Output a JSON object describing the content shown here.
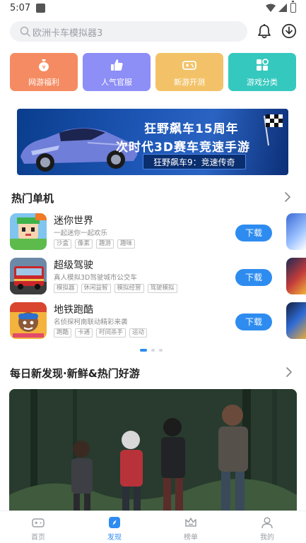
{
  "status_bar": {
    "time": "5:07"
  },
  "search": {
    "placeholder": "欧洲卡车模拟器3"
  },
  "tiles": [
    {
      "label": "网游福利",
      "color": "#f58b62"
    },
    {
      "label": "人气官服",
      "color": "#8d8ef6"
    },
    {
      "label": "新游开测",
      "color": "#f3c268"
    },
    {
      "label": "游戏分类",
      "color": "#35c8be"
    }
  ],
  "banner": {
    "line1": "狂野飙车15周年",
    "line2": "次时代3D赛车竞速手游",
    "subtitle": "狂野飙车9：竞速传奇"
  },
  "hot_section": {
    "title": "热门单机"
  },
  "games": [
    {
      "name": "迷你世界",
      "desc": "一起迷你一起欢乐",
      "tags": [
        "沙盒",
        "像素",
        "趣游",
        "趣味"
      ],
      "button": "下载"
    },
    {
      "name": "超级驾驶",
      "desc": "真人模拟3D驾驶城市公交车",
      "tags": [
        "模拟器",
        "休闲益智",
        "模拟经营",
        "驾驶模拟"
      ],
      "button": "下载"
    },
    {
      "name": "地铁跑酷",
      "desc": "名侦探柯南联动精彩来袭",
      "tags": [
        "跑酷",
        "卡通",
        "时间杀手",
        "运动"
      ],
      "button": "下载"
    }
  ],
  "pager": {
    "count": 3,
    "active_index": 0
  },
  "daily_section": {
    "title": "每日新发现·新鲜&热门好游"
  },
  "nav": [
    {
      "label": "首页",
      "icon": "gamepad-icon",
      "active": false
    },
    {
      "label": "发现",
      "icon": "compass-icon",
      "active": true
    },
    {
      "label": "榜单",
      "icon": "crown-icon",
      "active": false
    },
    {
      "label": "我的",
      "icon": "user-icon",
      "active": false
    }
  ],
  "colors": {
    "accent": "#2e8cf0",
    "page_bg": "#ffffff"
  }
}
